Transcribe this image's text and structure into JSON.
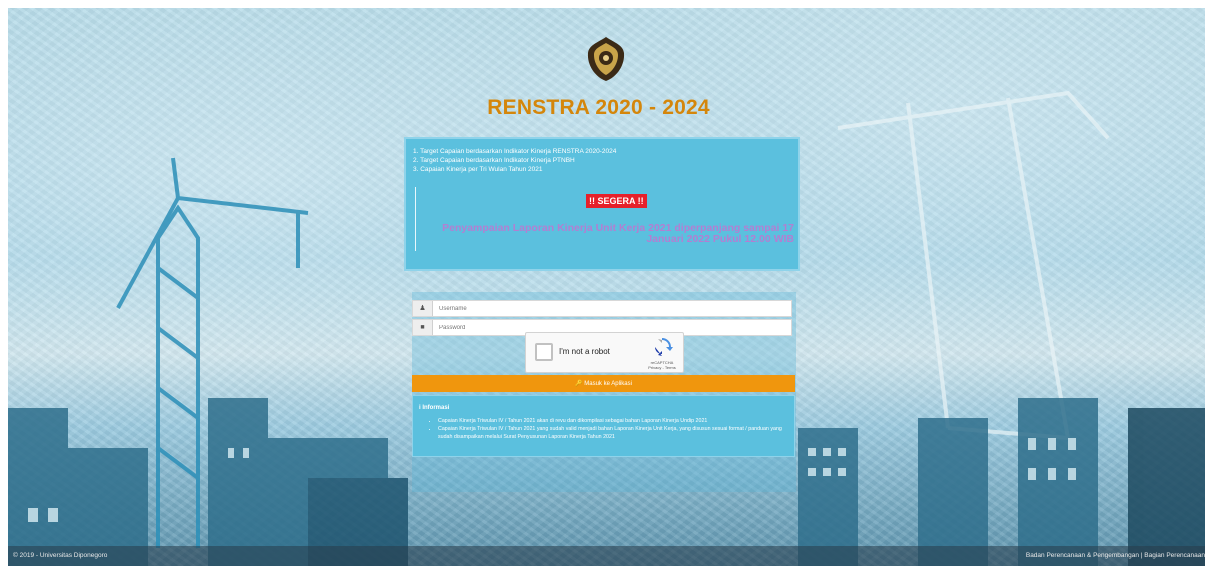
{
  "header": {
    "title": "RENSTRA 2020 - 2024"
  },
  "info_box": {
    "lines": [
      "1. Target Capaian berdasarkan Indikator Kinerja RENSTRA 2020-2024",
      "2. Target Capaian berdasarkan Indikator Kinerja PTNBH",
      "3. Capaian Kinerja per Tri Wulan Tahun 2021"
    ],
    "badge": "!! SEGERA !!",
    "notice": "Penyampaian Laporan Kinerja Unit Kerja 2021 diperpanjang sampai 17 Januari 2022 Pukul 12.00 WIB"
  },
  "login": {
    "username_placeholder": "Username",
    "password_placeholder": "Password",
    "captcha_label": "I'm not a robot",
    "captcha_brand": "reCAPTCHA",
    "captcha_links": "Privacy - Terms",
    "submit_label": "Masuk ke Aplikasi"
  },
  "informasi": {
    "heading": "Informasi",
    "items": [
      "Capaian Kinerja Triwulan IV / Tahun 2021 akan di revu dan dikompilasi sebagai bahan Laporan Kinerja Undip 2021",
      "Capaian Kinerja Triwulan IV / Tahun 2021 yang sudah valid menjadi bahan Laporan Kinerja Unit Kerja, yang disusun sesuai format / panduan yang sudah disampaikan melalui Surat Penyusunan Laporan Kinerja Tahun 2021"
    ]
  },
  "footer": {
    "left": "© 2019 - Universitas Diponegoro",
    "right": "Badan Perencanaan & Pengembangan | Bagian Perencanaan"
  },
  "colors": {
    "title": "#d4860b",
    "info_bg": "#5bc0de",
    "badge": "#e6202a",
    "notice": "#b27fd1",
    "button": "#f0960d"
  }
}
